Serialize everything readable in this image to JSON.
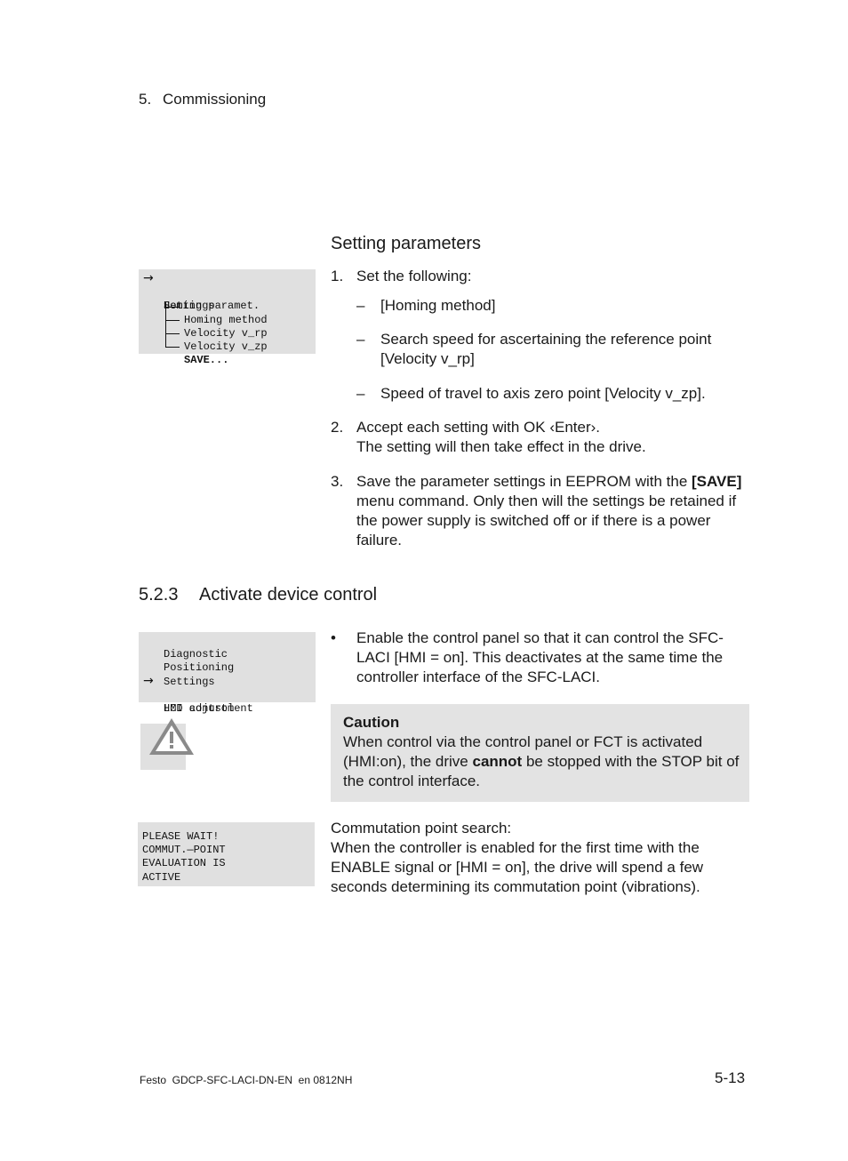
{
  "header": {
    "chapter_number": "5.",
    "chapter_title": "Commissioning"
  },
  "setting_parameters": {
    "heading": "Setting parameters",
    "lcd_menu": {
      "lines": [
        {
          "arrow": "→",
          "text": "Settings"
        },
        {
          "arrow": "",
          "text": "Homing paramet."
        },
        {
          "arrow": "",
          "text": "Homing method"
        },
        {
          "arrow": "",
          "text": "Velocity v_rp"
        },
        {
          "arrow": "",
          "text": "Velocity v_zp"
        },
        {
          "arrow": "",
          "text": "SAVE..."
        }
      ]
    },
    "steps": [
      {
        "number": "1.",
        "text": "Set the following:",
        "sub_items": [
          {
            "dash": "–",
            "text": "[Homing method]"
          },
          {
            "dash": "–",
            "text": "Search speed for ascertaining the reference point [Velocity v_rp]"
          },
          {
            "dash": "–",
            "text": "Speed of travel to axis zero point [Velocity v_zp]."
          }
        ]
      },
      {
        "number": "2.",
        "line1": "Accept each setting with OK ‹Enter›.",
        "line2": "The setting will then take effect in the drive."
      },
      {
        "number": "3.",
        "text_before": "Save the parameter settings in EEPROM with the ",
        "bold": "[SAVE]",
        "text_after": " menu command. Only then will the settings be retained if the power supply is switched off or if there is a power failure."
      }
    ]
  },
  "section_523": {
    "number": "5.2.3",
    "title": "Activate device control",
    "lcd_menu": {
      "lines": [
        {
          "arrow": "",
          "text": "Diagnostic"
        },
        {
          "arrow": "",
          "text": "Positioning"
        },
        {
          "arrow": "",
          "text": "Settings"
        },
        {
          "arrow": "→",
          "text": "HMI control"
        },
        {
          "arrow": "",
          "text": "LCD adjustment"
        }
      ]
    },
    "bullet": {
      "symbol": "•",
      "text": "Enable the control panel so that it can control the SFC-LACI [HMI = on]. This deactivates at the same time the controller interface of the SFC-LACI."
    },
    "caution": {
      "icon": "warning-triangle-icon",
      "title": "Caution",
      "text_before": "When control via the control panel or FCT is activated (HMI:on), the drive ",
      "bold": "cannot",
      "text_after": " be stopped with the STOP bit of the control interface."
    },
    "lcd_wait": {
      "lines": [
        "PLEASE WAIT!",
        "COMMUT.—POINT",
        "EVALUATION IS",
        "ACTIVE"
      ]
    },
    "commutation": {
      "title": "Commutation point search:",
      "text": "When the controller is enabled for the first time with the ENABLE signal or [HMI = on], the drive will spend a few seconds determining its commutation point (vibrations)."
    }
  },
  "footer": {
    "doc_id": "Festo  GDCP-SFC-LACI-DN-EN  en 0812NH",
    "page_number": "5-13"
  }
}
